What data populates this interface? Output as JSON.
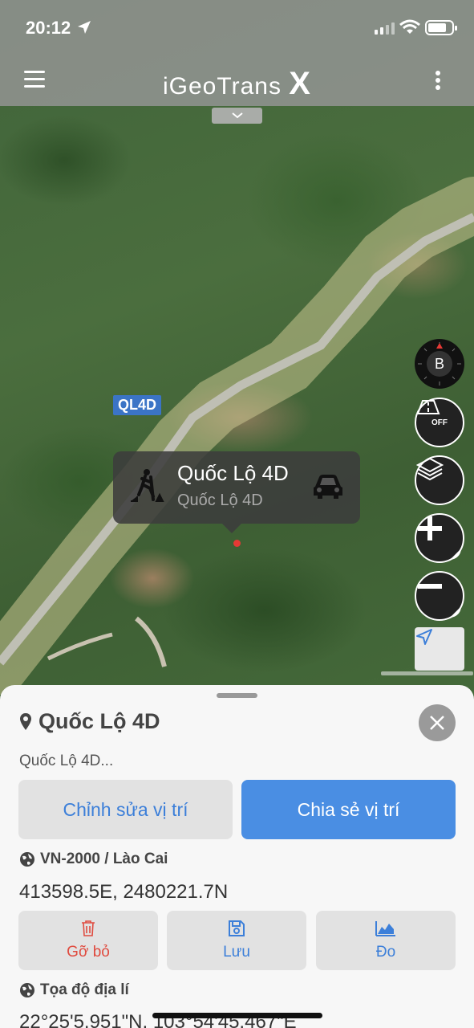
{
  "status_bar": {
    "time": "20:12"
  },
  "app_bar": {
    "title": "iGeoTrans",
    "title_suffix": "X"
  },
  "map": {
    "road_label": "QL4D",
    "callout": {
      "title": "Quốc Lộ 4D",
      "subtitle": "Quốc Lộ 4D"
    },
    "controls": {
      "compass_label": "B",
      "traffic_label": "OFF"
    }
  },
  "sheet": {
    "title": "Quốc Lộ 4D",
    "subtitle": "Quốc Lộ 4D...",
    "edit_label": "Chỉnh sửa vị trí",
    "share_label": "Chia sẻ vị trí",
    "coord_system": "VN-2000 / Lào Cai",
    "coord_value": "413598.5E, 2480221.7N",
    "actions": [
      {
        "label": "Gỡ bỏ",
        "icon": "trash-icon"
      },
      {
        "label": "Lưu",
        "icon": "save-icon"
      },
      {
        "label": "Đo",
        "icon": "measure-icon"
      }
    ],
    "geo_heading": "Tọa độ địa lí",
    "geo_value": "22°25'5.951\"N, 103°54'45.467\"E"
  },
  "colors": {
    "accent": "#4a8ee3",
    "danger": "#e04b3f",
    "road_label_bg": "#3b74c6"
  }
}
